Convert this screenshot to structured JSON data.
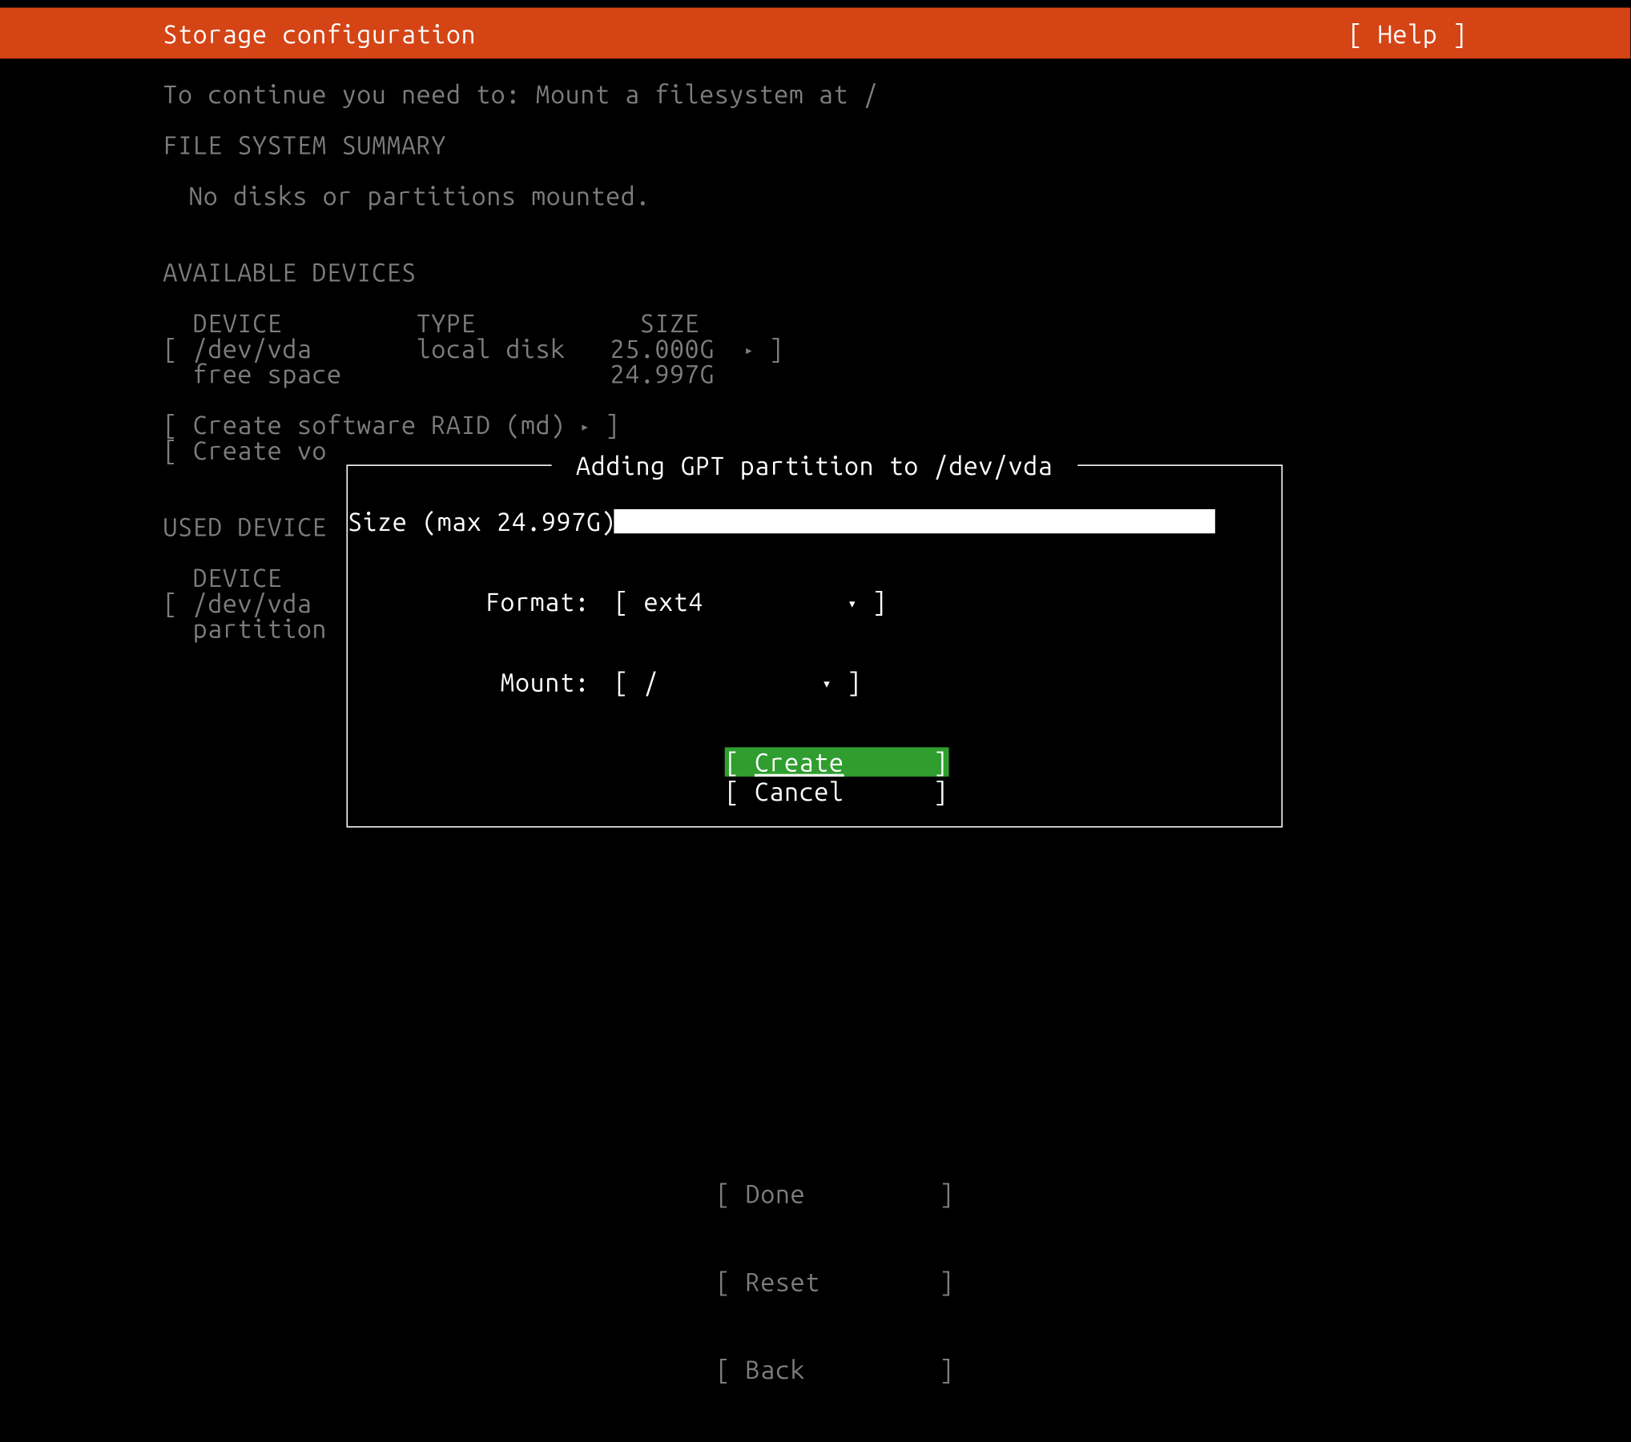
{
  "header": {
    "title": "Storage configuration",
    "help": "Help"
  },
  "hint": "To continue you need to: Mount a filesystem at /",
  "fs_summary_heading": "FILE SYSTEM SUMMARY",
  "fs_summary_empty": "No disks or partitions mounted.",
  "avail_heading": "AVAILABLE DEVICES",
  "cols": {
    "device": "DEVICE",
    "type": "TYPE",
    "size": "SIZE"
  },
  "dev": {
    "name": "/dev/vda",
    "type": "local disk",
    "size": "25.000G"
  },
  "free": {
    "label": "free space",
    "size": "24.997G"
  },
  "raid": "Create software RAID (md)",
  "vg_partial": "Create vo",
  "used_heading": "USED DEVICE",
  "used_cols": {
    "device": "DEVICE"
  },
  "used_dev": {
    "name": "/dev/vda",
    "sub": "partition"
  },
  "dialog": {
    "title": "Adding GPT partition to /dev/vda",
    "size_label": "Size (max 24.997G):",
    "format_label": "Format:",
    "format_value": "ext4",
    "mount_label": "Mount:",
    "mount_value": "/",
    "create": "Create",
    "cancel": "Cancel"
  },
  "footer": {
    "done": "Done",
    "reset": "Reset",
    "back": "Back"
  },
  "glyph": {
    "right": "▸",
    "down": "▾"
  }
}
